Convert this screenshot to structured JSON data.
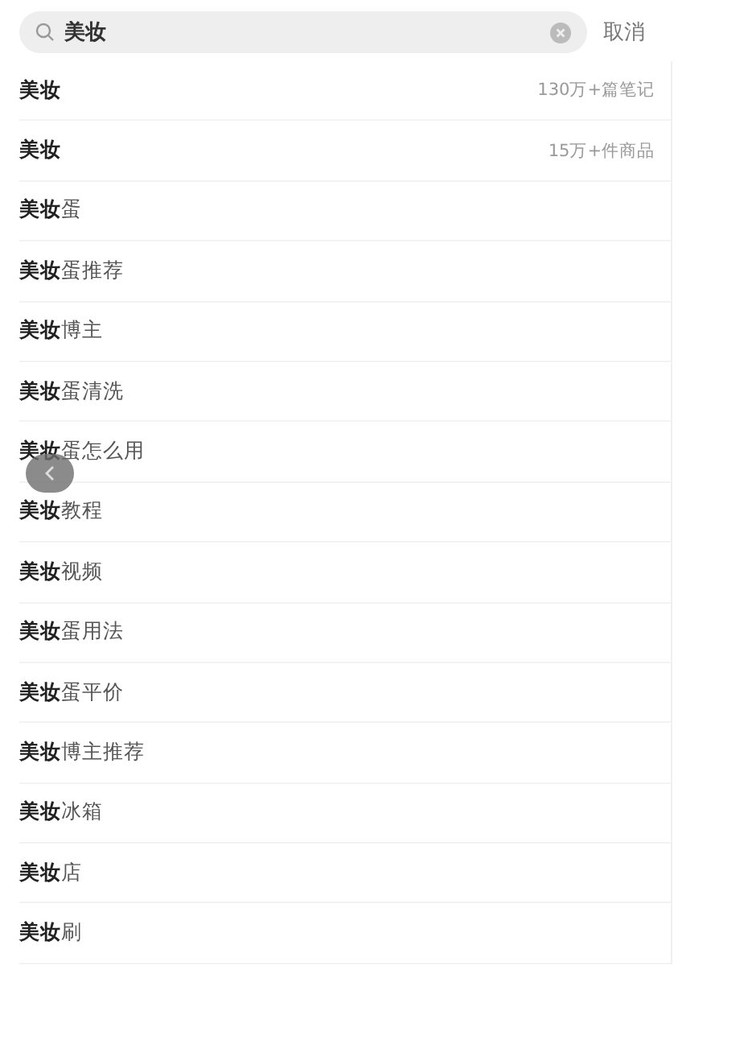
{
  "search": {
    "value": "美妆"
  },
  "cancel": "取消",
  "suggestions": [
    {
      "text": "**美妆**",
      "meta": "130万+篇笔记"
    },
    {
      "text": "**美妆**",
      "meta": "15万+件商品"
    },
    {
      "text": "**美妆**蛋"
    },
    {
      "text": "**美妆**蛋推荐"
    },
    {
      "text": "**美妆**博主"
    },
    {
      "text": "**美妆**蛋清洗"
    },
    {
      "text": "**美妆**蛋怎么用"
    },
    {
      "text": "**美妆**教程"
    },
    {
      "text": "**美妆**视频"
    },
    {
      "text": "**美妆**蛋用法"
    },
    {
      "text": "**美妆**蛋平价"
    },
    {
      "text": "**美妆**博主推荐"
    },
    {
      "text": "**美妆**冰箱"
    },
    {
      "text": "**美妆**店"
    },
    {
      "text": "**美妆**刷"
    }
  ]
}
